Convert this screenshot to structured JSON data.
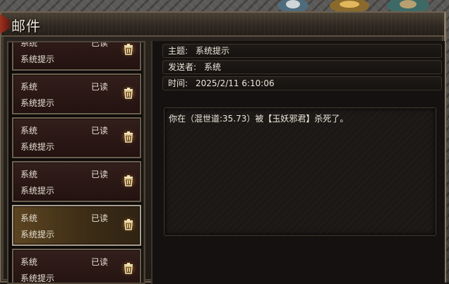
{
  "window": {
    "title": "邮件"
  },
  "mail_list": [
    {
      "sender": "系统",
      "status": "已读",
      "subject": "系统提示",
      "selected": false
    },
    {
      "sender": "系统",
      "status": "已读",
      "subject": "系统提示",
      "selected": false
    },
    {
      "sender": "系统",
      "status": "已读",
      "subject": "系统提示",
      "selected": false
    },
    {
      "sender": "系统",
      "status": "已读",
      "subject": "系统提示",
      "selected": false
    },
    {
      "sender": "系统",
      "status": "已读",
      "subject": "系统提示",
      "selected": true
    },
    {
      "sender": "系统",
      "status": "已读",
      "subject": "系统提示",
      "selected": false
    }
  ],
  "detail": {
    "subject_label": "主题:",
    "subject_value": "系统提示",
    "sender_label": "发送者:",
    "sender_value": "系统",
    "time_label": "时间:",
    "time_value": "2025/2/11 6:10:06",
    "body": "你在（混世道:35.73）被【玉妖邪君】杀死了。"
  },
  "icons": {
    "delete": "trash-icon",
    "close": "close-icon"
  },
  "colors": {
    "selected_item": "#5a4220",
    "text": "#e8e2d4",
    "frame": "#6e6150"
  }
}
